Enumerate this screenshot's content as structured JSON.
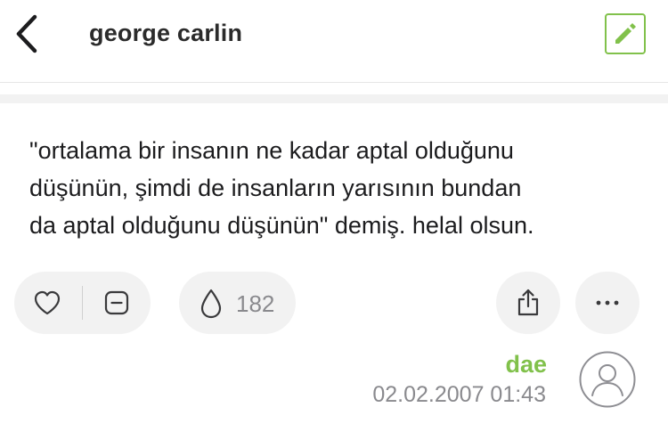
{
  "header": {
    "title": "george carlin",
    "back_icon": "chevron-left-icon",
    "edit_icon": "pencil-icon"
  },
  "entry": {
    "text": "\"ortalama bir insanın ne kadar aptal olduğunu\ndüşünün, şimdi de insanların yarısının bundan\nda aptal olduğunu düşünün\" demiş. helal olsun.",
    "favorite_count": "182",
    "author": "dae",
    "datetime": "02.02.2007 01:43"
  },
  "actions": {
    "upvote_icon": "heart-icon",
    "downvote_icon": "minus-box-icon",
    "favorite_icon": "drop-icon",
    "share_icon": "share-icon",
    "more_icon": "ellipsis-icon"
  },
  "colors": {
    "accent": "#81c14b",
    "pill_background": "#f2f2f2",
    "muted_text": "#8a8a8e",
    "text": "#1c1c1e"
  }
}
